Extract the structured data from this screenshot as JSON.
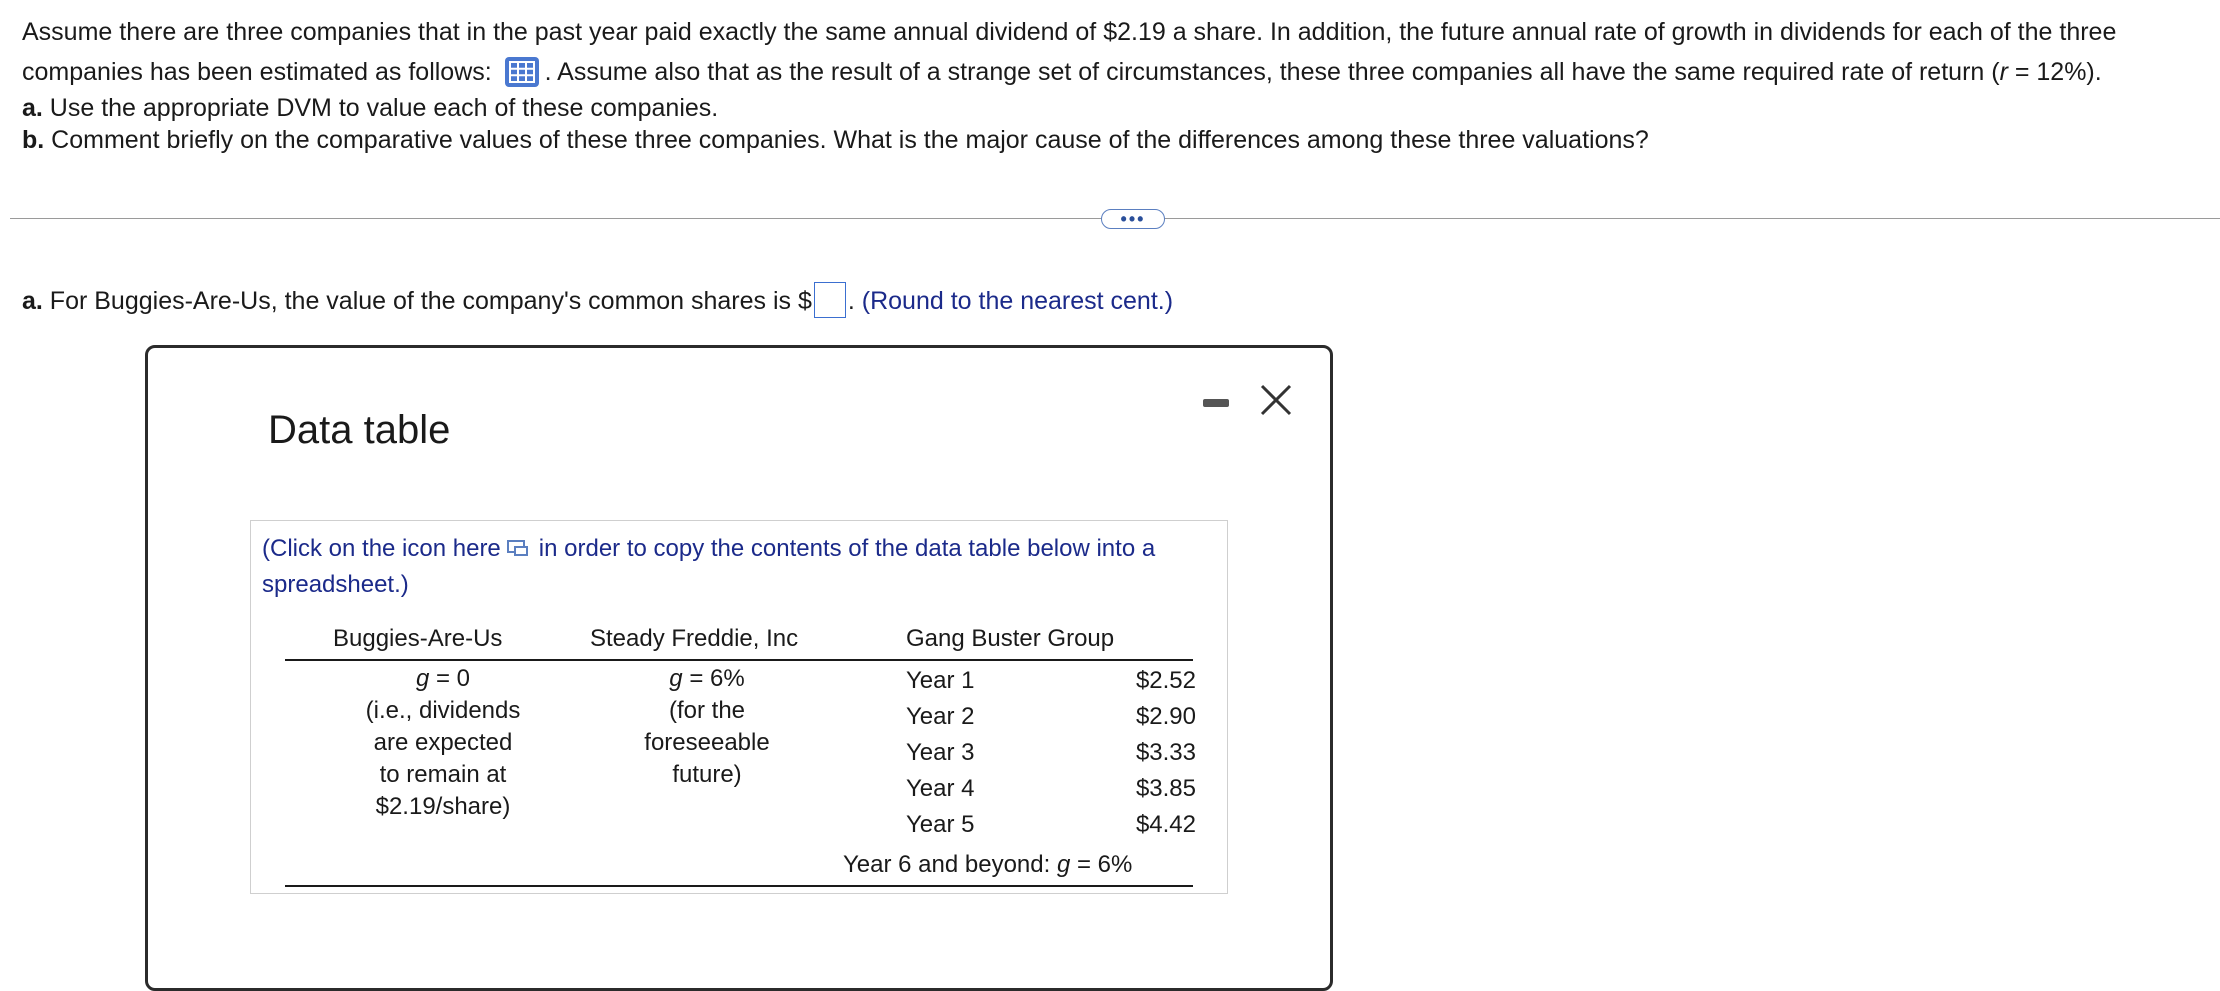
{
  "problem": {
    "line1": "Assume there are three companies that in the past year paid exactly the same annual dividend of $2.19 a share. In addition, the future annual rate of growth in dividends for each of the three",
    "line2_before": "companies has been estimated as follows:",
    "line2_after": ". Assume also that as the result of a strange set of circumstances, these three companies all have the same required rate of return (",
    "line2_var": "r",
    "line2_end": " = 12%).",
    "part_a_label": "a.",
    "part_a_text": " Use the appropriate DVM to value each of these companies.",
    "part_b_label": "b.",
    "part_b_text": " Comment briefly on the comparative values of these three companies. What is the major cause of the differences among these three valuations?"
  },
  "more_button": "•••",
  "answer": {
    "label": "a.",
    "text_before": " For Buggies-Are-Us, the value of the company's common shares is $",
    "text_after": ".",
    "hint": "(Round to the nearest cent.)",
    "value": ""
  },
  "dialog": {
    "title": "Data table",
    "copy_note_before": "(Click on the icon here",
    "copy_note_after": "in order to copy the contents of the data table below into a spreadsheet.)",
    "table": {
      "headers": [
        "Buggies-Are-Us",
        "Steady Freddie, Inc",
        "Gang Buster Group"
      ],
      "buggies": {
        "g_var": "g",
        "g_value": " = 0",
        "lines": [
          "(i.e., dividends",
          "are expected",
          "to remain at",
          "$2.19/share)"
        ]
      },
      "freddie": {
        "g_var": "g",
        "g_value": " = 6%",
        "lines": [
          "(for the",
          "foreseeable",
          "future)"
        ]
      },
      "gang": {
        "rows": [
          {
            "year": "Year 1",
            "amount": "$2.52"
          },
          {
            "year": "Year 2",
            "amount": "$2.90"
          },
          {
            "year": "Year 3",
            "amount": "$3.33"
          },
          {
            "year": "Year 4",
            "amount": "$3.85"
          },
          {
            "year": "Year 5",
            "amount": "$4.42"
          }
        ],
        "beyond_text": "Year 6 and beyond: ",
        "beyond_var": "g",
        "beyond_value": " = 6%"
      }
    }
  },
  "colors": {
    "hint_text": "#1b2a8a",
    "icon_blue": "#4a78d0",
    "answer_border": "#3b6fd0"
  }
}
